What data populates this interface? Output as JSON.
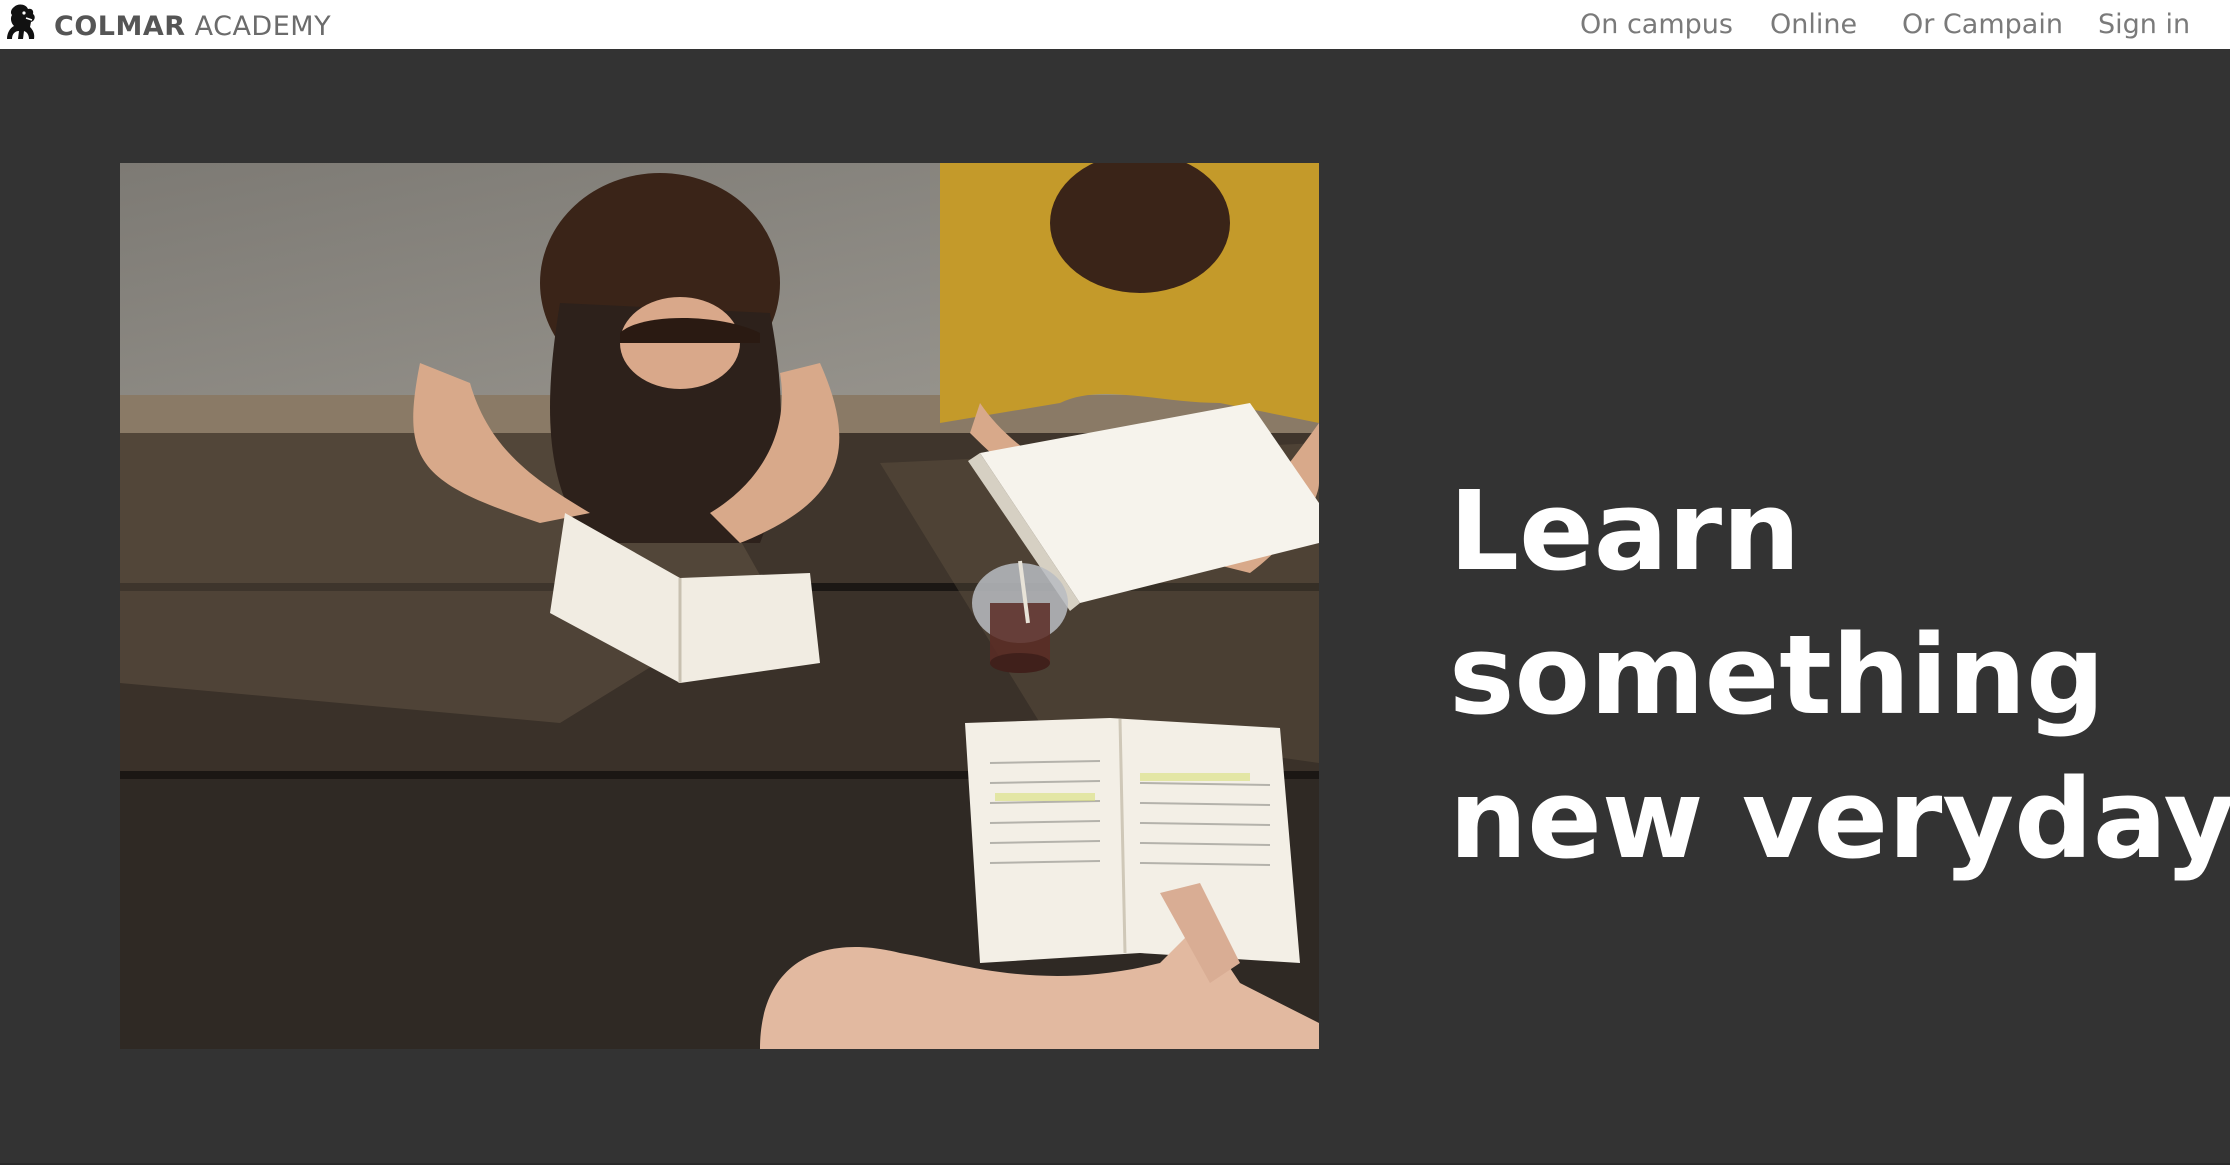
{
  "header": {
    "brand_bold": "COLMAR",
    "brand_rest": " ACADEMY",
    "logo_icon": "lion-rampant-icon",
    "nav": {
      "on_campus": "On campus",
      "online": "Online",
      "or_campain": "Or Campain",
      "sign_in": "Sign in"
    }
  },
  "hero": {
    "image_icon": "students-studying-photo",
    "headline": {
      "line1": "Learn",
      "line2": "something",
      "line3": "new veryday"
    }
  },
  "colors": {
    "background": "#333333",
    "header_bg": "#ffffff",
    "nav_text": "#7a7a7a",
    "headline": "#ffffff"
  }
}
